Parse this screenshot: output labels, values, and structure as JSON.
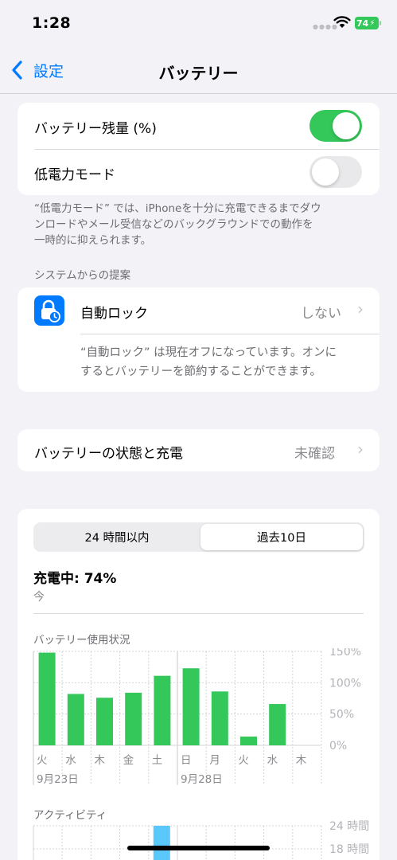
{
  "status_bar": {
    "time": "1:28",
    "battery_level": "74",
    "battery_color": "#34c759"
  },
  "nav": {
    "back_label": "設定",
    "title": "バッテリー"
  },
  "settings": {
    "battery_percentage": {
      "label": "バッテリー残量 (%)",
      "enabled": true
    },
    "low_power_mode": {
      "label": "低電力モード",
      "enabled": false
    },
    "low_power_footnote_line1": "“低電力モード” では、iPhoneを十分に充電できるまでダウ",
    "low_power_footnote_line2": "ンロードやメール受信などのバックグラウンドでの動作を",
    "low_power_footnote_line3": "一時的に抑えられます。"
  },
  "suggestions": {
    "header": "システムからの提案",
    "auto_lock": {
      "icon": "lock-clock-icon",
      "icon_color": "#007aff",
      "label": "自動ロック",
      "value": "しない",
      "note_line1": "“自動ロック” は現在オフになっています。オンに",
      "note_line2": "するとバッテリーを節約することができます。"
    }
  },
  "health": {
    "label": "バッテリーの状態と充電",
    "value": "未確認"
  },
  "usage": {
    "tabs": [
      "24 時間以内",
      "過去10日"
    ],
    "selected_tab": 1,
    "charging_status": "充電中: 74%",
    "charging_time": "今",
    "chart_title": "バッテリー使用状況",
    "activity_title": "アクティビティ"
  },
  "chart_data": [
    {
      "type": "bar",
      "title": "バッテリー使用状況",
      "categories": [
        "火",
        "水",
        "木",
        "金",
        "土",
        "日",
        "月",
        "火",
        "水",
        "木"
      ],
      "date_labels": [
        {
          "category_index": 0,
          "label": "9月23日"
        },
        {
          "category_index": 5,
          "label": "9月28日"
        }
      ],
      "values": [
        148,
        82,
        76,
        84,
        111,
        123,
        86,
        14,
        66,
        0
      ],
      "y_ticks": [
        "150%",
        "100%",
        "50%",
        "0%"
      ],
      "ylim": [
        0,
        150
      ],
      "bar_color": "#34c759",
      "grid": true
    },
    {
      "type": "bar",
      "title": "アクティビティ",
      "y_ticks": [
        "24 時間",
        "18 時間"
      ],
      "bar_color": "#5ac8fa"
    }
  ]
}
